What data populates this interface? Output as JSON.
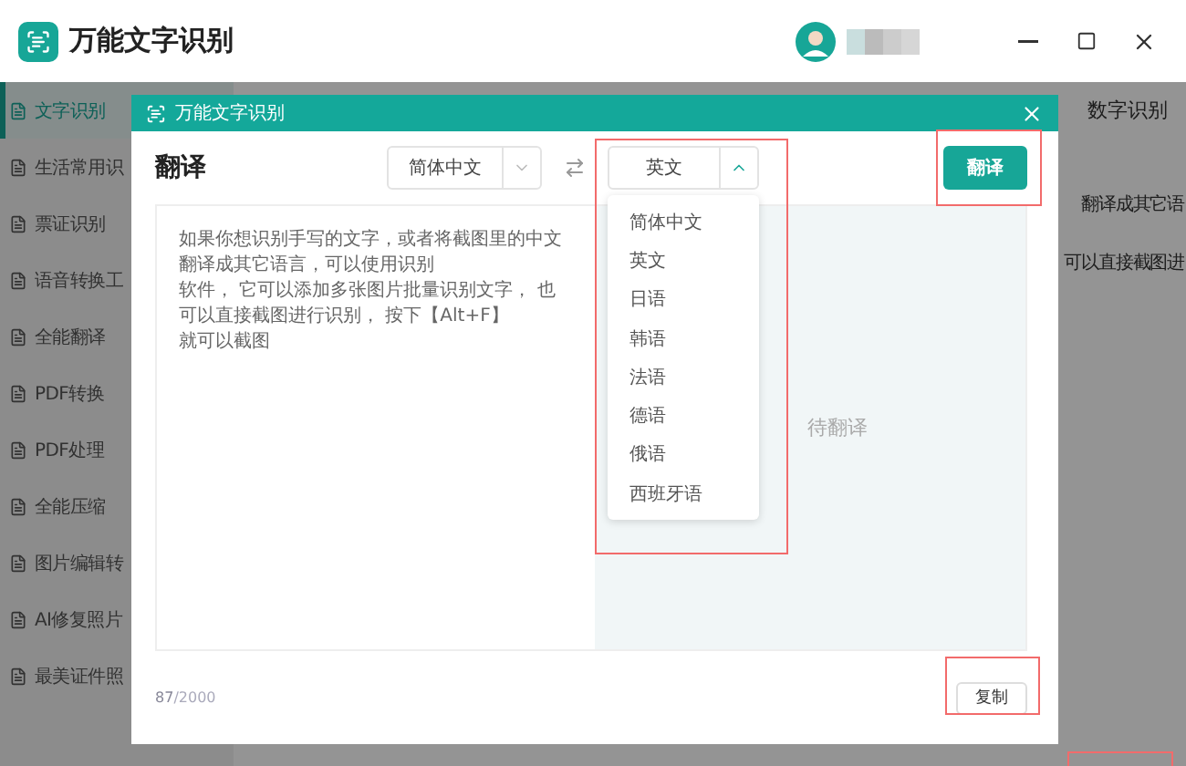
{
  "window": {
    "title": "万能文字识别"
  },
  "sidebar": {
    "items": [
      {
        "label": "文字识别",
        "selected": true
      },
      {
        "label": "生活常用识",
        "selected": false
      },
      {
        "label": "票证识别",
        "selected": false
      },
      {
        "label": "语音转换工",
        "selected": false
      },
      {
        "label": "全能翻译",
        "selected": false
      },
      {
        "label": "PDF转换",
        "selected": false
      },
      {
        "label": "PDF处理",
        "selected": false
      },
      {
        "label": "全能压缩",
        "selected": false
      },
      {
        "label": "图片编辑转",
        "selected": false
      },
      {
        "label": "AI修复照片",
        "selected": false
      },
      {
        "label": "最美证件照",
        "selected": false
      }
    ]
  },
  "tab_label": "数字识别",
  "background_text": [
    "翻译成其它语",
    "可以直接截图进"
  ],
  "dialog": {
    "title": "万能文字识别",
    "heading": "翻译",
    "source_language": "简体中文",
    "target_language": "英文",
    "target_expanded": true,
    "options": [
      "简体中文",
      "英文",
      "日语",
      "韩语",
      "法语",
      "德语",
      "俄语",
      "西班牙语"
    ],
    "translate_button": "翻译",
    "input_lines": [
      "如果你想识别手写的文字，或者将截图里的中文翻译成其它语言，可以使用识别",
      "软件， 它可以添加多张图片批量识别文字， 也可以直接截图进行识别， 按下【Alt+F】",
      "就可以截图"
    ],
    "output_placeholder": "待翻译",
    "count": "87",
    "limit": "/2000",
    "copy_button": "复制"
  }
}
